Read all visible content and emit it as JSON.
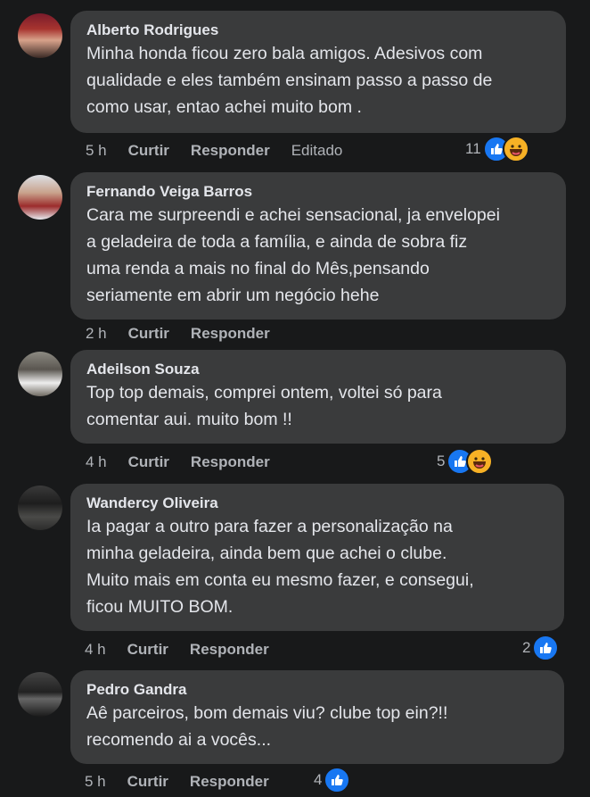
{
  "actions": {
    "like": "Curtir",
    "reply": "Responder",
    "edited": "Editado"
  },
  "comments": [
    {
      "author": "Alberto Rodrigues",
      "lines": [
        "Minha honda ficou zero bala amigos. Adesivos com",
        "qualidade e eles também ensinam passo a passo de",
        "como usar, entao achei muito bom ."
      ],
      "time": "5 h",
      "reaction_count": "11",
      "reactions": [
        "like-icon",
        "haha-icon"
      ]
    },
    {
      "author": "Fernando Veiga Barros",
      "lines": [
        "Cara me surpreendi e achei sensacional, ja envelopei",
        "a geladeira de toda a família, e ainda de sobra fiz",
        "uma renda a mais no final do Mês,pensando",
        "seriamente em abrir um negócio hehe"
      ],
      "time": "2 h",
      "reaction_count": "",
      "reactions": []
    },
    {
      "author": "Adeilson Souza",
      "lines": [
        "Top top demais, comprei ontem, voltei só para",
        "comentar aui. muito bom !!"
      ],
      "time": "4 h",
      "reaction_count": "5",
      "reactions": [
        "like-icon",
        "haha-icon"
      ]
    },
    {
      "author": "Wandercy Oliveira",
      "lines": [
        "Ia pagar a outro para fazer a personalização na",
        "minha geladeira, ainda bem que achei o clube.",
        "Muito mais em conta eu mesmo fazer, e consegui,",
        "ficou MUITO BOM."
      ],
      "time": "4 h",
      "reaction_count": "2",
      "reactions": [
        "like-icon"
      ]
    },
    {
      "author": "Pedro Gandra",
      "lines": [
        "Aê parceiros, bom demais viu? clube top ein?!!",
        "recomendo ai a vocês..."
      ],
      "time": "5 h",
      "reaction_count": "4",
      "reactions": [
        "like-icon"
      ]
    }
  ],
  "colors": {
    "background": "#18191a",
    "bubble": "#3a3b3c",
    "text": "#e4e6eb",
    "muted": "#b0b3b8",
    "like": "#1877f2",
    "haha": "#f7b125"
  }
}
